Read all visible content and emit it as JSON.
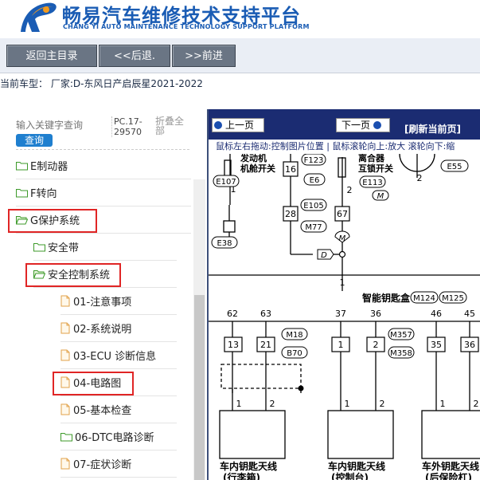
{
  "header": {
    "title": "畅易汽车维修技术支持平台",
    "subtitle": "CHANG YI AUTO MAINTENANCE TECHNOLOGY SUPPORT PLATFORM"
  },
  "nav": {
    "home_label": "返回主目录",
    "back_label": "<<后退.",
    "forward_label": ">>前进"
  },
  "vehicle": {
    "text": "当前车型： 厂家:D-东风日产启辰星2021-2022"
  },
  "search": {
    "placeholder": "输入关键字查询",
    "button_label": "查询",
    "pc_number": "PC.17-29570",
    "fold_label": "折叠全部"
  },
  "tree": [
    {
      "label": "E制动器",
      "icon": "folder-icon"
    },
    {
      "label": "F转向",
      "icon": "folder-icon"
    },
    {
      "label": "G保护系统",
      "icon": "folder-open-icon",
      "highlighted": true
    },
    {
      "label": "安全带",
      "icon": "folder-icon"
    },
    {
      "label": "安全控制系统",
      "icon": "folder-open-icon",
      "highlighted": true
    },
    {
      "label": "01-注意事项",
      "icon": "document-icon"
    },
    {
      "label": "02-系统说明",
      "icon": "document-icon"
    },
    {
      "label": "03-ECU 诊断信息",
      "icon": "document-icon"
    },
    {
      "label": "04-电路图",
      "icon": "document-icon",
      "highlighted": true
    },
    {
      "label": "05-基本检查",
      "icon": "document-icon"
    },
    {
      "label": "06-DTC电路诊断",
      "icon": "folder-icon"
    },
    {
      "label": "07-症状诊断",
      "icon": "document-icon"
    }
  ],
  "viewer": {
    "prev_label": "上一页",
    "next_label": "下一页",
    "refresh_label": "[刷新当前页]",
    "hint": "鼠标左右拖动:控制图片位置 | 鼠标滚轮向上:放大  滚轮向下:缩"
  },
  "diagram": {
    "labels": {
      "engine_hood": [
        "发动机",
        "机舱开关"
      ],
      "clutch": [
        "离合器",
        "互锁开关"
      ],
      "smart_key_box": "智能钥匙盒",
      "antenna1": [
        "车内钥匙天线",
        "(行李箱)"
      ],
      "antenna2": [
        "车内钥匙天线",
        "(控制台)"
      ],
      "antenna3": [
        "车外钥匙天线",
        "(后保险杠)"
      ]
    },
    "connectors": [
      "E107",
      "F123",
      "E6",
      "E113",
      "M",
      "E105",
      "M77",
      "E38",
      "D",
      "M",
      "E55",
      "M124",
      "M125",
      "M18",
      "B70",
      "M357",
      "M358"
    ],
    "pins_top": [
      "16",
      "28",
      "67",
      "2",
      "1",
      "2"
    ],
    "pins_box": [
      "62",
      "63",
      "37",
      "36",
      "46",
      "45"
    ],
    "pins_conn": [
      "13",
      "21",
      "1",
      "2",
      "35",
      "36"
    ],
    "pins_bottom": [
      "1",
      "2",
      "1",
      "2",
      "1",
      "2"
    ],
    "node_label": "1"
  },
  "colors": {
    "brand_blue": "#1a5cb4",
    "nav_button": "#6a7584",
    "viewer_bar": "#1b2c72",
    "highlight": "#e02525",
    "search_button": "#1f7fcf"
  }
}
